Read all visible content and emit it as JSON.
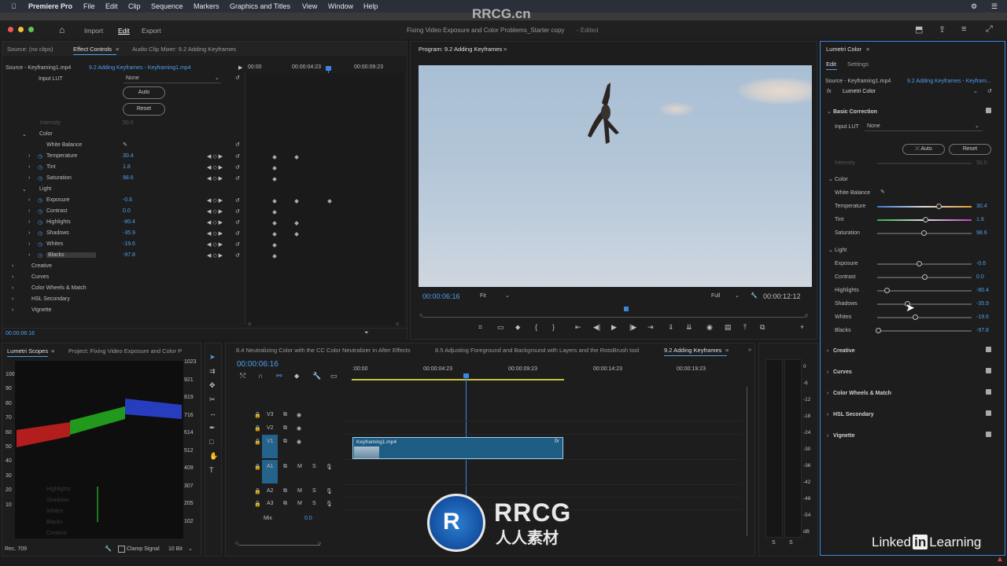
{
  "menubar": {
    "app": "Premiere Pro",
    "items": [
      "File",
      "Edit",
      "Clip",
      "Sequence",
      "Markers",
      "Graphics and Titles",
      "View",
      "Window",
      "Help"
    ]
  },
  "workspace": {
    "tabs": [
      "Import",
      "Edit",
      "Export"
    ],
    "title": "Fixing Video Exposure and Color Problems_Starter copy",
    "edited": "- Edited"
  },
  "source_panel": {
    "tabs": [
      "Source: (no clips)",
      "Effect Controls",
      "Audio Clip Mixer: 9.2 Adding Keyframes"
    ],
    "source_clip": "Source - Keyframing1.mp4",
    "sequence_clip": "9.2 Adding Keyframes - Keyframing1.mp4",
    "ruler": [
      "00:00",
      "00:00:04:23",
      "00:00:09:23"
    ],
    "input_lut_label": "Input LUT",
    "input_lut_value": "None",
    "auto": "Auto",
    "reset": "Reset",
    "intensity_label": "Intensity",
    "intensity_value": "50.0",
    "color_label": "Color",
    "white_balance": "White Balance",
    "color_params": [
      {
        "label": "Temperature",
        "value": "30.4"
      },
      {
        "label": "Tint",
        "value": "1.8"
      },
      {
        "label": "Saturation",
        "value": "98.6"
      }
    ],
    "light_label": "Light",
    "light_params": [
      {
        "label": "Exposure",
        "value": "-0.6"
      },
      {
        "label": "Contrast",
        "value": "0.0"
      },
      {
        "label": "Highlights",
        "value": "-80.4"
      },
      {
        "label": "Shadows",
        "value": "-35.9"
      },
      {
        "label": "Whites",
        "value": "-19.6"
      },
      {
        "label": "Blacks",
        "value": "-97.8"
      }
    ],
    "sections": [
      "Creative",
      "Curves",
      "Color Wheels & Match",
      "HSL Secondary",
      "Vignette"
    ],
    "timecode": "00:00:06:16"
  },
  "program": {
    "title": "Program: 9.2 Adding Keyframes",
    "timecode": "00:00:06:16",
    "fit": "Fit",
    "quality": "Full",
    "duration": "00:00:12:12"
  },
  "lumetri": {
    "title": "Lumetri Color",
    "tabs": [
      "Edit",
      "Settings"
    ],
    "source": "Source - Keyframing1.mp4",
    "sequence": "9.2 Adding Keyframes - Keyfram...",
    "fx_label": "Lumetri Color",
    "basic": "Basic Correction",
    "input_lut_label": "Input LUT",
    "input_lut_value": "None",
    "auto": "Auto",
    "reset": "Reset",
    "intensity_label": "Intensity",
    "intensity_value": "50.0",
    "color_label": "Color",
    "white_balance": "White Balance",
    "color_params": [
      {
        "label": "Temperature",
        "value": "30.4",
        "pos": 0.65,
        "grad": "linear-gradient(90deg,#3a7bd5,#ddd,#e0a030)"
      },
      {
        "label": "Tint",
        "value": "1.8",
        "pos": 0.51,
        "grad": "linear-gradient(90deg,#2bb34a,#ddd,#c040c0)"
      },
      {
        "label": "Saturation",
        "value": "98.6",
        "pos": 0.49,
        "grad": "linear-gradient(90deg,#555,#555)"
      }
    ],
    "light_label": "Light",
    "light_params": [
      {
        "label": "Exposure",
        "value": "-0.6",
        "pos": 0.44
      },
      {
        "label": "Contrast",
        "value": "0.0",
        "pos": 0.5
      },
      {
        "label": "Highlights",
        "value": "-80.4",
        "pos": 0.1
      },
      {
        "label": "Shadows",
        "value": "-35.9",
        "pos": 0.32
      },
      {
        "label": "Whites",
        "value": "-19.6",
        "pos": 0.4
      },
      {
        "label": "Blacks",
        "value": "-97.8",
        "pos": 0.01
      }
    ],
    "sections": [
      "Creative",
      "Curves",
      "Color Wheels & Match",
      "HSL Secondary",
      "Vignette"
    ]
  },
  "scopes": {
    "tabs": [
      "Lumetri Scopes",
      "Project: Fixing Video Exposure and Color P"
    ],
    "scale": [
      "1023",
      "921",
      "819",
      "716",
      "614",
      "512",
      "409",
      "307",
      "205",
      "102"
    ],
    "left_scale": [
      "100",
      "90",
      "80",
      "70",
      "60",
      "50",
      "40",
      "30",
      "20",
      "10"
    ],
    "footer_left": "Rec. 709",
    "clamp": "Clamp Signal",
    "bits": "10 Bit",
    "ghost_rows": [
      "Highlights",
      "Shadows",
      "Whites",
      "Blacks",
      "Creative"
    ]
  },
  "timeline": {
    "tabs": [
      "8.4 Neutralizing Color with the CC Color Neutralizer in After Effects",
      "8.5 Adjusting Foreground and Background with Layers and the RotoBrush tool",
      "9.2 Adding Keyframes"
    ],
    "timecode": "00:00:06:16",
    "ruler": [
      ":00:00",
      "00:00:04:23",
      "00:00:09:23",
      "00:00:14:23",
      "00:00:19:23"
    ],
    "tracks": [
      "V3",
      "V2",
      "V1",
      "A1",
      "A2",
      "A3"
    ],
    "mix": "Mix",
    "mix_value": "0.0",
    "clip": "Keyframing1.mp4",
    "meter": [
      "0",
      "-6",
      "-12",
      "-18",
      "-24",
      "-30",
      "-36",
      "-42",
      "-48",
      "-54",
      "dB"
    ]
  },
  "watermark": {
    "top": "RRCG.cn",
    "brand": "RRCG",
    "sub": "人人素材",
    "linkedin": "Linked",
    "in": "in",
    "learning": "Learning"
  }
}
